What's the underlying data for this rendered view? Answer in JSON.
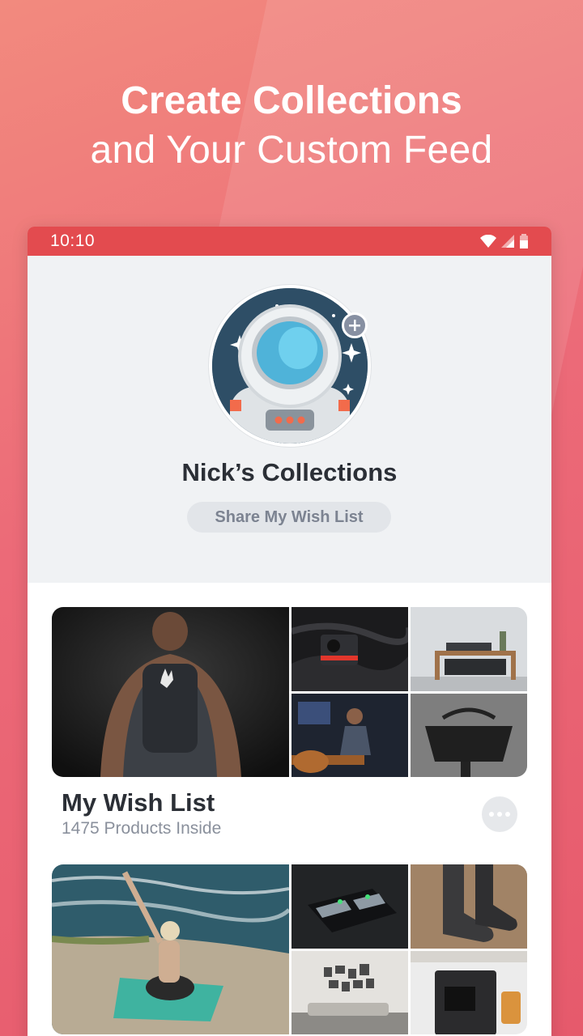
{
  "headline": {
    "line1": "Create Collections",
    "line2": "and Your Custom Feed"
  },
  "status_bar": {
    "time": "10:10",
    "icons": [
      "wifi-icon",
      "signal-icon",
      "battery-icon"
    ]
  },
  "profile": {
    "avatar": "astronaut-avatar",
    "add_icon": "plus-icon",
    "name": "Nick’s Collections",
    "share_label": "Share My Wish List"
  },
  "collections": [
    {
      "title": "My Wish List",
      "count_label": "1475 Products Inside",
      "more_icon": "more-horizontal-icon",
      "images": [
        "backpack-vest-photo",
        "action-camera-photo",
        "turntable-console-photo",
        "rowing-machine-photo",
        "duffel-bag-photo"
      ]
    },
    {
      "images": [
        "beach-yoga-photo",
        "wireless-charger-photo",
        "wool-socks-photo",
        "photo-wall-room-photo",
        "espresso-machine-photo"
      ]
    }
  ],
  "colors": {
    "status_bar": "#e34b4f",
    "profile_bg": "#f0f2f4",
    "avatar_bg": "#2e4e66",
    "title_text": "#2b2f36",
    "muted_text": "#8a909c"
  }
}
